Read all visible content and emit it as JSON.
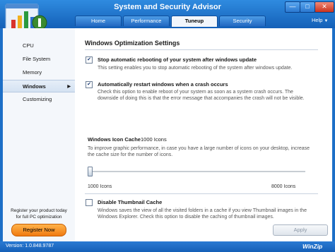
{
  "window": {
    "title": "System and Security Advisor",
    "controls": {
      "minimize": "—",
      "maximize": "□",
      "close": "✕"
    }
  },
  "tabs": [
    {
      "label": "Home",
      "active": false
    },
    {
      "label": "Performance",
      "active": false
    },
    {
      "label": "Tuneup",
      "active": true
    },
    {
      "label": "Security",
      "active": false
    }
  ],
  "help": {
    "label": "Help",
    "caret": "▼"
  },
  "sidebar": {
    "items": [
      {
        "label": "CPU"
      },
      {
        "label": "File System"
      },
      {
        "label": "Memory"
      },
      {
        "label": "Windows",
        "active": true,
        "arrow": "▶"
      },
      {
        "label": "Customizing"
      }
    ],
    "promo_line1": "Register your product today",
    "promo_line2": "for full PC optimization",
    "register_label": "Register Now"
  },
  "main": {
    "section_title": "Windows Optimization Settings",
    "options": [
      {
        "checked": true,
        "title": "Stop automatic rebooting of your system after windows update",
        "desc": "This setting enables you to stop automatic rebooting of the system after windows update."
      },
      {
        "checked": true,
        "title": "Automatically restart windows when a crash occurs",
        "desc": "Check this option to enable reboot of your system as soon as a system crash occurs. The downside of doing this is that the error message that accompanies the crash will not be visible."
      },
      {
        "checked": false,
        "title": "Disable Thumbnail Cache",
        "desc": "Windows saves the view of all the visited folders in a cache if you view Thumbnail images in the Windows Explorer. Check this option to disable the caching of thumbnail images."
      }
    ],
    "icon_cache": {
      "label": "Windows Icon Cache",
      "value": "1000 Icons",
      "desc": "To improve graphic performance, in case you have a large number of icons on your desktop, increase the cache size for the number of icons.",
      "min_label": "1000 Icons",
      "max_label": "8000 Icons",
      "slider_fraction": 0.0
    },
    "apply_label": "Apply"
  },
  "status": {
    "version": "Version: 1.0.848.9787",
    "brand": "WinZip"
  },
  "colors": {
    "frame": "#1d6fc7",
    "register_button": "#f07a10",
    "active_tab": "#f1f6fc"
  },
  "icons": [
    "logo-icon",
    "checkmark-icon",
    "chevron-right-icon",
    "chevron-down-icon"
  ]
}
